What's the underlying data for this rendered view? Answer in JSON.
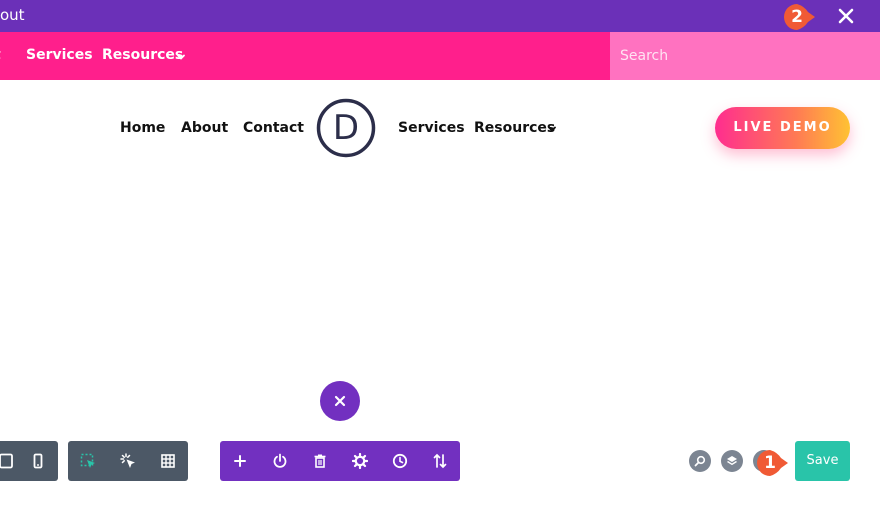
{
  "titlebar": {
    "title": "out"
  },
  "topnav": {
    "items": [
      {
        "label": "t"
      },
      {
        "label": "Services"
      },
      {
        "label": "Resources"
      }
    ],
    "search_placeholder": "Search"
  },
  "header": {
    "items_left": [
      {
        "label": "Home"
      },
      {
        "label": "About"
      },
      {
        "label": "Contact"
      }
    ],
    "logo_letter": "D",
    "items_right": [
      {
        "label": "Services"
      },
      {
        "label": "Resources"
      }
    ],
    "cta_label": "LIVE DEMO"
  },
  "footer": {
    "save_label": "Save"
  },
  "annotations": {
    "badge1": "1",
    "badge2": "2"
  },
  "colors": {
    "titlebar": "#6b30b8",
    "pinkbar": "#ff1f8c",
    "search_bg": "#ff72c0",
    "toolbar_dark": "#4c5866",
    "toolbar_purple": "#7230c0",
    "save": "#29c4a9",
    "badge": "#f05a35"
  }
}
